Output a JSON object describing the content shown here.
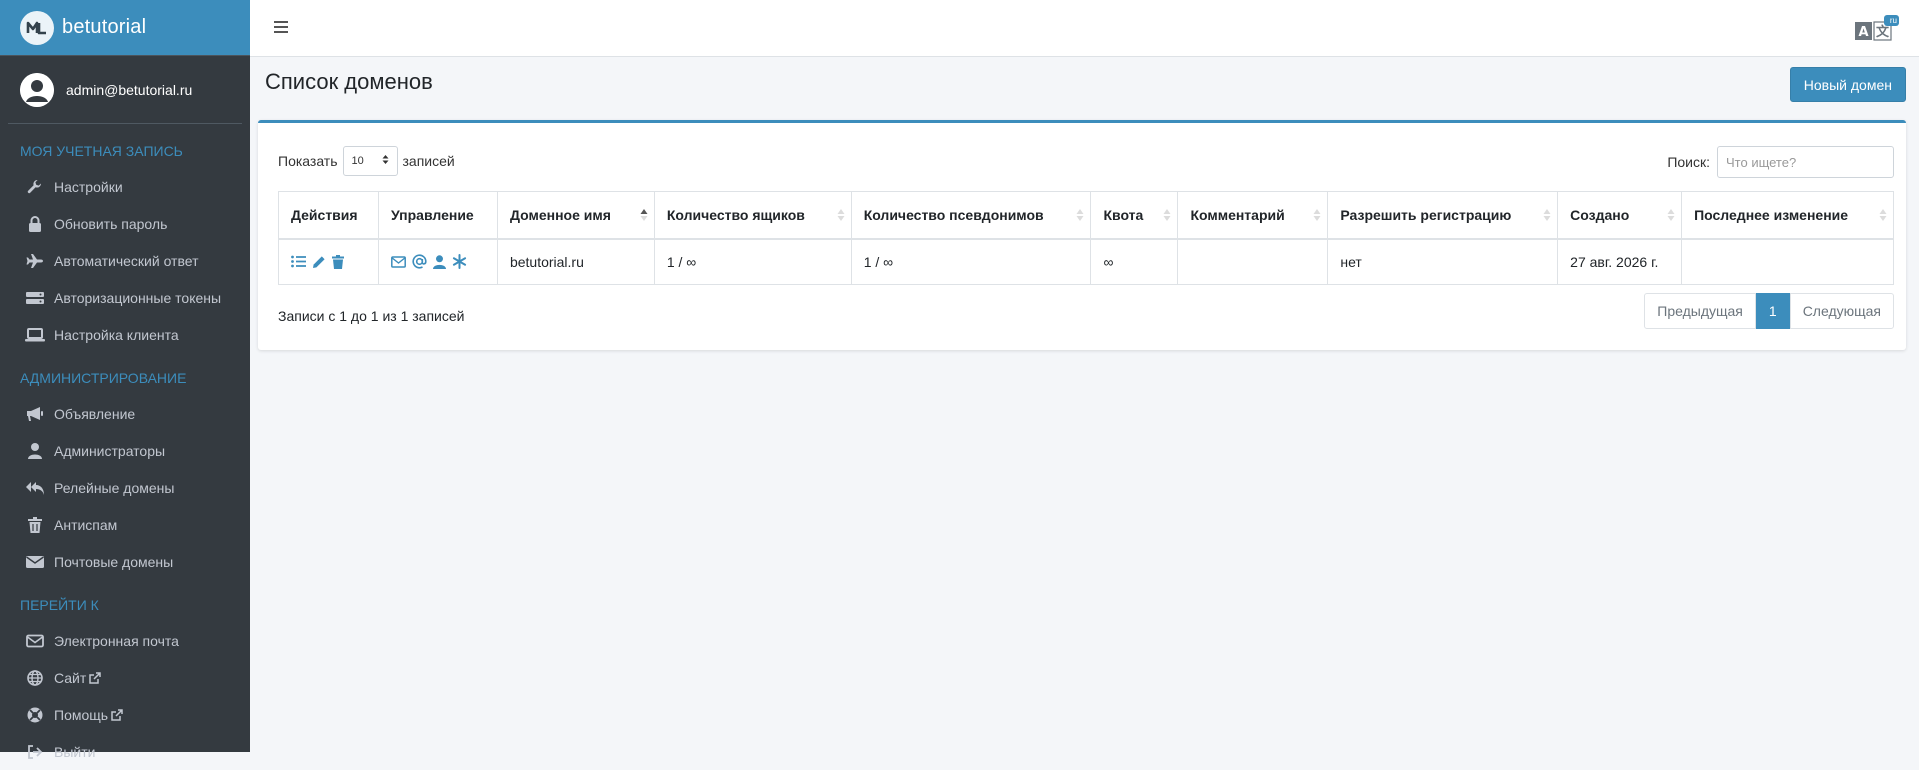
{
  "brand": {
    "name": "betutorial"
  },
  "user": {
    "email": "admin@betutorial.ru"
  },
  "sidebar": {
    "sections": [
      {
        "header": "Моя учетная запись",
        "items": [
          "Настройки",
          "Обновить пароль",
          "Автоматический ответ",
          "Авторизационные токены",
          "Настройка клиента"
        ]
      },
      {
        "header": "Администрирование",
        "items": [
          "Объявление",
          "Администраторы",
          "Релейные домены",
          "Антиспам",
          "Почтовые домены"
        ]
      },
      {
        "header": "Перейти к",
        "items": [
          "Электронная почта",
          "Сайт",
          "Помощь",
          "Выйти"
        ]
      }
    ]
  },
  "language": {
    "badge": "ru"
  },
  "page": {
    "title": "Список доменов",
    "new_button": "Новый домен"
  },
  "table_controls": {
    "show_label": "Показать",
    "page_length": "10",
    "records_label": "записей",
    "search_label": "Поиск:",
    "search_placeholder": "Что ищете?"
  },
  "table": {
    "columns": [
      "Действия",
      "Управление",
      "Доменное имя",
      "Количество ящиков",
      "Количество псевдонимов",
      "Квота",
      "Комментарий",
      "Разрешить регистрацию",
      "Создано",
      "Последнее изменение"
    ],
    "rows": [
      {
        "domain": "betutorial.ru",
        "mailboxes": "1 / ∞",
        "aliases": "1 / ∞",
        "quota": "∞",
        "comment": "",
        "allow_registration": "нет",
        "created": "27 авг. 2026 г.",
        "modified": ""
      }
    ],
    "info": "Записи с 1 до 1 из 1 записей"
  },
  "pagination": {
    "previous": "Предыдущая",
    "current": "1",
    "next": "Следующая"
  },
  "colors": {
    "accent": "#3c8dbc",
    "sidebar_bg": "#343a40"
  },
  "icons": {
    "actions": [
      "list-icon",
      "pencil-icon",
      "trash-icon"
    ],
    "management": [
      "envelope-icon",
      "at-icon",
      "user-icon",
      "asterisk-icon"
    ]
  }
}
